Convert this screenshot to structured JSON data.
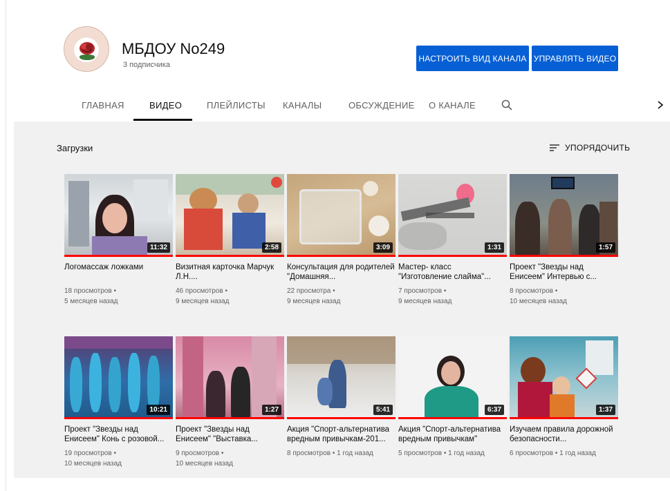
{
  "channel": {
    "name": "МБДОУ No249",
    "subscribers": "3 подписчика",
    "avatar_text": "МБДОУ №249 ЮМБКА"
  },
  "buttons": {
    "customize": "НАСТРОИТЬ ВИД КАНАЛА",
    "manage": "УПРАВЛЯТЬ ВИДЕО"
  },
  "tabs": [
    {
      "label": "ГЛАВНАЯ",
      "active": false
    },
    {
      "label": "ВИДЕО",
      "active": true
    },
    {
      "label": "ПЛЕЙЛИСТЫ",
      "active": false
    },
    {
      "label": "КАНАЛЫ",
      "active": false
    },
    {
      "label": "ОБСУЖДЕНИЕ",
      "active": false
    },
    {
      "label": "О КАНАЛЕ",
      "active": false
    }
  ],
  "icons": {
    "search": "search-icon",
    "next": "chevron-right-icon",
    "sort": "sort-icon"
  },
  "section": {
    "title": "Загрузки",
    "sort_label": "УПОРЯДОЧИТЬ"
  },
  "colors": {
    "accent_button": "#065fd4",
    "progress": "#ff0000",
    "background": "#f1f1f1"
  },
  "videos": [
    {
      "title": "Логомассаж ложками",
      "views": "18 просмотров •",
      "age": "5 месяцев назад",
      "duration": "11:32"
    },
    {
      "title": "Визитная карточка Марчук Л.Н....",
      "views": "46 просмотров •",
      "age": "9 месяцев назад",
      "duration": "2:58"
    },
    {
      "title": "Консультация для родителей \"Домашняя...",
      "views": "22 просмотра •",
      "age": "9 месяцев назад",
      "duration": "3:09"
    },
    {
      "title": "Мастер- класс \"Изготовление слайма\"...",
      "views": "7 просмотров •",
      "age": "9 месяцев назад",
      "duration": "1:31"
    },
    {
      "title": "Проект \"Звезды над Енисеем\" Интервью с...",
      "views": "8 просмотров •",
      "age": "10 месяцев назад",
      "duration": "1:57"
    },
    {
      "title": "Проект \"Звезды над Енисеем\" Конь с розовой...",
      "views": "19 просмотров •",
      "age": "10 месяцев назад",
      "duration": "10:21"
    },
    {
      "title": "Проект \"Звезды над Енисеем\" \"Выставка...",
      "views": "9 просмотров •",
      "age": "10 месяцев назад",
      "duration": "1:27"
    },
    {
      "title": "Акция \"Спорт-альтернатива вредным привычкам-201...",
      "views": "8 просмотров • 1 год назад",
      "age": "",
      "duration": "5:41"
    },
    {
      "title": "Акция \"Спорт-альтернатива вредным привычкам\"",
      "views": "5 просмотров • 1 год назад",
      "age": "",
      "duration": "6:37"
    },
    {
      "title": "Изучаем правила дорожной безопасности...",
      "views": "6 просмотров • 1 год назад",
      "age": "",
      "duration": "1:37"
    }
  ]
}
